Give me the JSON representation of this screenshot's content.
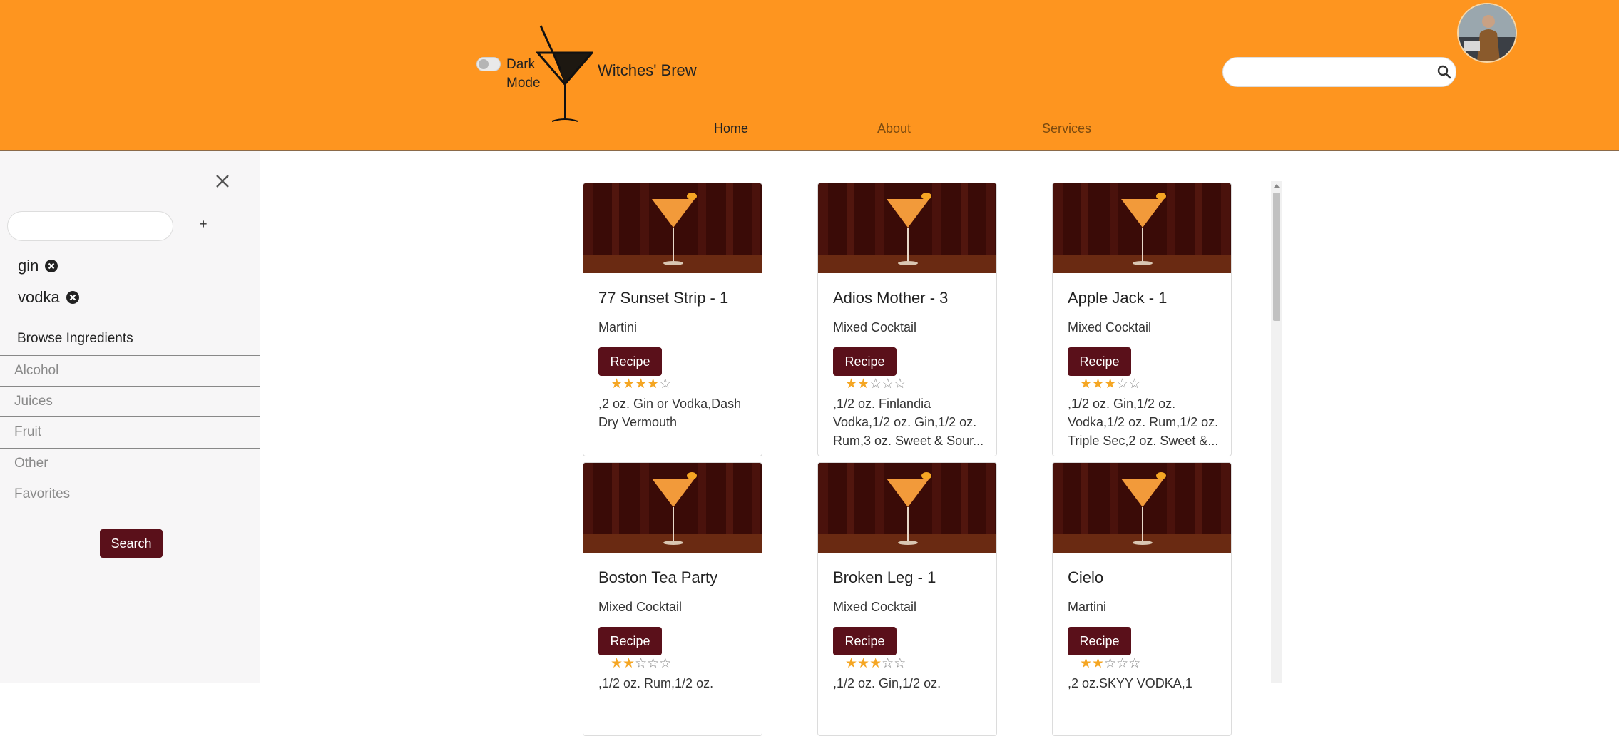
{
  "header": {
    "dark_mode_label": "Dark Mode",
    "brand": "Witches' Brew",
    "search_value": "",
    "nav": [
      {
        "label": "Home"
      },
      {
        "label": "About"
      },
      {
        "label": "Services"
      }
    ]
  },
  "sidebar": {
    "ingredient_input_value": "",
    "add_label": "+",
    "chips": [
      {
        "label": "gin"
      },
      {
        "label": "vodka"
      }
    ],
    "browse_title": "Browse Ingredients",
    "categories": [
      {
        "label": "Alcohol"
      },
      {
        "label": "Juices"
      },
      {
        "label": "Fruit"
      },
      {
        "label": "Other"
      },
      {
        "label": "Favorites"
      }
    ],
    "search_button": "Search"
  },
  "cards": [
    {
      "title": "77 Sunset Strip - 1",
      "subtitle": "Martini",
      "button": "Recipe",
      "rating": 4,
      "ingredients": ",2 oz. Gin or Vodka,Dash Dry Vermouth"
    },
    {
      "title": "Adios Mother - 3",
      "subtitle": "Mixed Cocktail",
      "button": "Recipe",
      "rating": 2,
      "ingredients": ",1/2 oz. Finlandia Vodka,1/2 oz. Gin,1/2 oz. Rum,3 oz. Sweet & Sour..."
    },
    {
      "title": "Apple Jack - 1",
      "subtitle": "Mixed Cocktail",
      "button": "Recipe",
      "rating": 3,
      "ingredients": ",1/2 oz. Gin,1/2 oz. Vodka,1/2 oz. Rum,1/2 oz. Triple Sec,2 oz. Sweet &..."
    },
    {
      "title": "Boston Tea Party",
      "subtitle": "Mixed Cocktail",
      "button": "Recipe",
      "rating": 2,
      "ingredients": ",1/2 oz. Rum,1/2 oz."
    },
    {
      "title": "Broken Leg - 1",
      "subtitle": "Mixed Cocktail",
      "button": "Recipe",
      "rating": 3,
      "ingredients": ",1/2 oz. Gin,1/2 oz."
    },
    {
      "title": "Cielo",
      "subtitle": "Martini",
      "button": "Recipe",
      "rating": 2,
      "ingredients": ",2 oz.SKYY VODKA,1"
    }
  ],
  "colors": {
    "header_bg": "#FE951F",
    "button_bg": "#5A101A",
    "star_on": "#F5A623"
  }
}
